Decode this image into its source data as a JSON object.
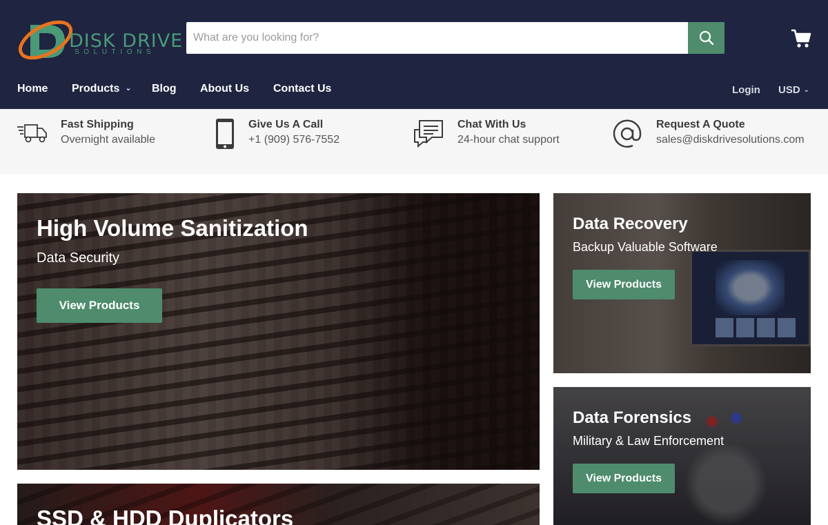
{
  "brand": {
    "name": "DISK DRIVE",
    "tagline": "SOLUTIONS",
    "logo_letter": "D"
  },
  "search": {
    "placeholder": "What are you looking for?",
    "value": ""
  },
  "nav": {
    "items": [
      {
        "label": "Home"
      },
      {
        "label": "Products",
        "has_dropdown": true
      },
      {
        "label": "Blog"
      },
      {
        "label": "About Us"
      },
      {
        "label": "Contact Us"
      }
    ],
    "login_label": "Login",
    "currency": "USD"
  },
  "features": [
    {
      "title": "Fast Shipping",
      "subtitle": "Overnight available",
      "icon": "truck-icon"
    },
    {
      "title": "Give Us A Call",
      "subtitle": "+1 (909) 576-7552",
      "icon": "phone-icon"
    },
    {
      "title": "Chat With Us",
      "subtitle": "24-hour chat support",
      "icon": "chat-icon"
    },
    {
      "title": "Request A Quote",
      "subtitle": "sales@diskdrivesolutions.com",
      "icon": "at-sign-icon"
    }
  ],
  "promos": [
    {
      "title": "High Volume Sanitization",
      "subtitle": "Data Security",
      "button": "View Products"
    },
    {
      "title": "Data Recovery",
      "subtitle": "Backup Valuable Software",
      "button": "View Products"
    },
    {
      "title": "Data Forensics",
      "subtitle": "Military & Law Enforcement",
      "button": "View Products"
    },
    {
      "title": "SSD & HDD Duplicators",
      "subtitle": "",
      "button": ""
    }
  ],
  "colors": {
    "header_bg": "#1f2440",
    "accent": "#4e8c6d",
    "features_bg": "#f6f6f6"
  }
}
